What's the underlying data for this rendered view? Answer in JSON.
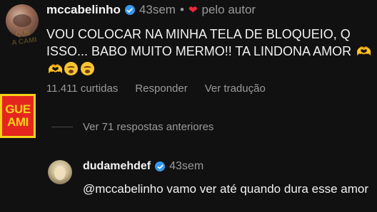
{
  "main_comment": {
    "username": "mccabelinho",
    "time": "43sem",
    "separator": "•",
    "liked_by": "pelo autor",
    "text": "VOU COLOCAR NA MINHA TELA DE BLOQUEIO, Q ISSO... BABO MUITO MERMO!! TA LINDONA AMOR",
    "emojis": [
      "heart-hands",
      "heart-hands",
      "tired-face",
      "tired-face"
    ],
    "likes": "11.411 curtidas",
    "reply_label": "Responder",
    "translate_label": "Ver tradução"
  },
  "side_logo": {
    "lines": [
      "GUE",
      "AMI"
    ]
  },
  "watermark": {
    "lines": [
      "QUE",
      "A CAMI"
    ]
  },
  "view_replies_label": "Ver 71 respostas anteriores",
  "reply": {
    "username": "dudamehdef",
    "time": "43sem",
    "mention": "@mccabelinho",
    "text": " vamo ver até quando dura esse amor"
  },
  "colors": {
    "background": "#111112",
    "verified": "#3897f0",
    "heart": "#ed2a3a",
    "mention": "#f2f2f2",
    "logo_red": "#e4261f",
    "logo_yellow": "#f5d21a"
  }
}
